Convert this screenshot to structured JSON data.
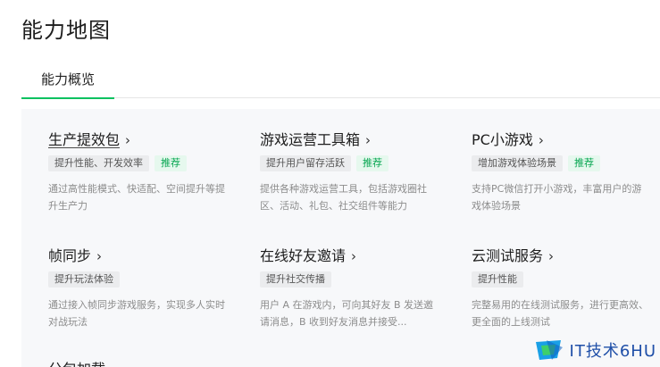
{
  "page": {
    "title": "能力地图",
    "tabs": [
      {
        "label": "能力概览",
        "active": true
      }
    ],
    "accent_color": "#07c160"
  },
  "cards": [
    {
      "title": "生产提效包",
      "tag": "提升性能、开发效率",
      "recommend": "推荐",
      "desc": "通过高性能模式、快适配、空间提升等提升生产力"
    },
    {
      "title": "游戏运营工具箱",
      "tag": "提升用户留存活跃",
      "recommend": "推荐",
      "desc": "提供各种游戏运营工具，包括游戏圈社区、活动、礼包、社交组件等能力"
    },
    {
      "title": "PC小游戏",
      "tag": "增加游戏体验场景",
      "recommend": "推荐",
      "desc": "支持PC微信打开小游戏，丰富用户的游戏体验场景"
    },
    {
      "title": "帧同步",
      "tag": "提升玩法体验",
      "recommend": "",
      "desc": "通过接入帧同步游戏服务，实现多人实时对战玩法"
    },
    {
      "title": "在线好友邀请",
      "tag": "提升社交传播",
      "recommend": "",
      "desc": "用户 A 在游戏内，可向其好友 B 发送邀请消息，B 收到好友消息并接受..."
    },
    {
      "title": "云测试服务",
      "tag": "提升性能",
      "recommend": "",
      "desc": "完整易用的在线测试服务，进行更高效、更全面的上线测试"
    }
  ],
  "partial_title": "分包加载",
  "watermark": {
    "text": "IT技术6HU"
  }
}
